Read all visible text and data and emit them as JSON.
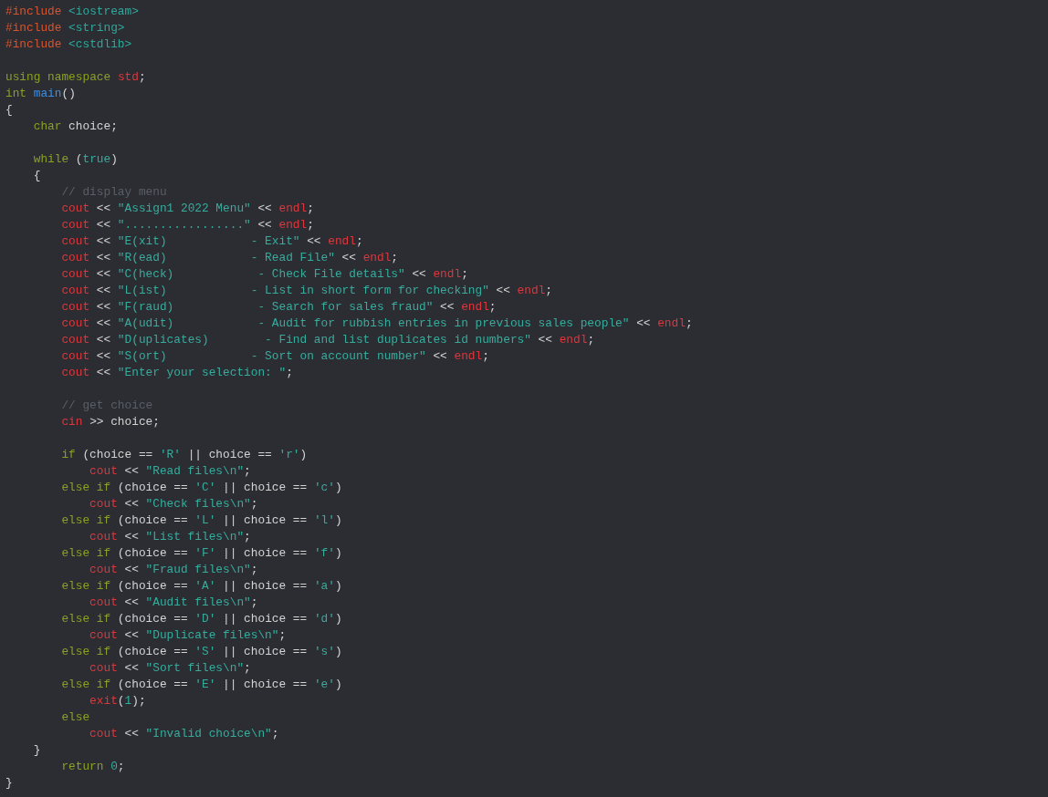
{
  "editor": {
    "lines": [
      {
        "kind": "code",
        "tokens": [
          {
            "kind": "pp",
            "text": "#include"
          },
          {
            "kind": "inc",
            "text": " <iostream>"
          }
        ]
      },
      {
        "kind": "code",
        "tokens": [
          {
            "kind": "pp",
            "text": "#include"
          },
          {
            "kind": "inc",
            "text": " <string>"
          }
        ]
      },
      {
        "kind": "code",
        "tokens": [
          {
            "kind": "pp",
            "text": "#include"
          },
          {
            "kind": "inc",
            "text": " <cstdlib>"
          }
        ]
      },
      {
        "kind": "blank"
      },
      {
        "kind": "code",
        "tokens": [
          {
            "kind": "kw",
            "text": "using namespace"
          },
          {
            "kind": "ns",
            "text": " std"
          },
          {
            "kind": "p",
            "text": ";"
          }
        ]
      },
      {
        "kind": "code",
        "tokens": [
          {
            "kind": "kw",
            "text": "int"
          },
          {
            "kind": "fn",
            "text": " main"
          },
          {
            "kind": "p",
            "text": "()"
          }
        ]
      },
      {
        "kind": "code",
        "tokens": [
          {
            "kind": "p",
            "text": "{"
          }
        ]
      },
      {
        "kind": "block",
        "children": [
          {
            "kind": "code",
            "tokens": [
              {
                "kind": "kw",
                "text": "char"
              },
              {
                "kind": "p",
                "text": " choice;"
              }
            ]
          },
          {
            "kind": "blank"
          },
          {
            "kind": "code",
            "tokens": [
              {
                "kind": "kw",
                "text": "while"
              },
              {
                "kind": "p",
                "text": " ("
              },
              {
                "kind": "n",
                "text": "true"
              },
              {
                "kind": "p",
                "text": ")"
              }
            ]
          },
          {
            "kind": "code",
            "tokens": [
              {
                "kind": "p",
                "text": "{"
              }
            ]
          },
          {
            "kind": "block",
            "children": [
              {
                "kind": "code",
                "tokens": [
                  {
                    "kind": "c",
                    "text": "// display menu"
                  }
                ]
              },
              {
                "kind": "code",
                "tokens": [
                  {
                    "kind": "io",
                    "text": "cout"
                  },
                  {
                    "kind": "p",
                    "text": " << "
                  },
                  {
                    "kind": "s",
                    "text": "\"Assign1 2022 Menu\""
                  },
                  {
                    "kind": "p",
                    "text": " << "
                  },
                  {
                    "kind": "io",
                    "text": "endl"
                  },
                  {
                    "kind": "p",
                    "text": ";"
                  }
                ]
              },
              {
                "kind": "code",
                "tokens": [
                  {
                    "kind": "io",
                    "text": "cout"
                  },
                  {
                    "kind": "p",
                    "text": " << "
                  },
                  {
                    "kind": "s",
                    "text": "\".................\""
                  },
                  {
                    "kind": "p",
                    "text": " << "
                  },
                  {
                    "kind": "io",
                    "text": "endl"
                  },
                  {
                    "kind": "p",
                    "text": ";"
                  }
                ]
              },
              {
                "kind": "code",
                "tokens": [
                  {
                    "kind": "io",
                    "text": "cout"
                  },
                  {
                    "kind": "p",
                    "text": " << "
                  },
                  {
                    "kind": "s",
                    "text": "\"E(xit)            - Exit\""
                  },
                  {
                    "kind": "p",
                    "text": " << "
                  },
                  {
                    "kind": "io",
                    "text": "endl"
                  },
                  {
                    "kind": "p",
                    "text": ";"
                  }
                ]
              },
              {
                "kind": "code",
                "tokens": [
                  {
                    "kind": "io",
                    "text": "cout"
                  },
                  {
                    "kind": "p",
                    "text": " << "
                  },
                  {
                    "kind": "s",
                    "text": "\"R(ead)            - Read File\""
                  },
                  {
                    "kind": "p",
                    "text": " << "
                  },
                  {
                    "kind": "io",
                    "text": "endl"
                  },
                  {
                    "kind": "p",
                    "text": ";"
                  }
                ]
              },
              {
                "kind": "code",
                "tokens": [
                  {
                    "kind": "io",
                    "text": "cout"
                  },
                  {
                    "kind": "p",
                    "text": " << "
                  },
                  {
                    "kind": "s",
                    "text": "\"C(heck)            - Check File details\""
                  },
                  {
                    "kind": "p",
                    "text": " << "
                  },
                  {
                    "kind": "io",
                    "text": "endl"
                  },
                  {
                    "kind": "p",
                    "text": ";"
                  }
                ]
              },
              {
                "kind": "code",
                "tokens": [
                  {
                    "kind": "io",
                    "text": "cout"
                  },
                  {
                    "kind": "p",
                    "text": " << "
                  },
                  {
                    "kind": "s",
                    "text": "\"L(ist)            - List in short form for checking\""
                  },
                  {
                    "kind": "p",
                    "text": " << "
                  },
                  {
                    "kind": "io",
                    "text": "endl"
                  },
                  {
                    "kind": "p",
                    "text": ";"
                  }
                ]
              },
              {
                "kind": "code",
                "tokens": [
                  {
                    "kind": "io",
                    "text": "cout"
                  },
                  {
                    "kind": "p",
                    "text": " << "
                  },
                  {
                    "kind": "s",
                    "text": "\"F(raud)            - Search for sales fraud\""
                  },
                  {
                    "kind": "p",
                    "text": " << "
                  },
                  {
                    "kind": "io",
                    "text": "endl"
                  },
                  {
                    "kind": "p",
                    "text": ";"
                  }
                ]
              },
              {
                "kind": "code",
                "tokens": [
                  {
                    "kind": "io",
                    "text": "cout"
                  },
                  {
                    "kind": "p",
                    "text": " << "
                  },
                  {
                    "kind": "s",
                    "text": "\"A(udit)            - Audit for rubbish entries in previous sales people\""
                  },
                  {
                    "kind": "p",
                    "text": " << "
                  },
                  {
                    "kind": "io",
                    "text": "endl"
                  },
                  {
                    "kind": "p",
                    "text": ";"
                  }
                ]
              },
              {
                "kind": "code",
                "tokens": [
                  {
                    "kind": "io",
                    "text": "cout"
                  },
                  {
                    "kind": "p",
                    "text": " << "
                  },
                  {
                    "kind": "s",
                    "text": "\"D(uplicates)        - Find and list duplicates id numbers\""
                  },
                  {
                    "kind": "p",
                    "text": " << "
                  },
                  {
                    "kind": "io",
                    "text": "endl"
                  },
                  {
                    "kind": "p",
                    "text": ";"
                  }
                ]
              },
              {
                "kind": "code",
                "tokens": [
                  {
                    "kind": "io",
                    "text": "cout"
                  },
                  {
                    "kind": "p",
                    "text": " << "
                  },
                  {
                    "kind": "s",
                    "text": "\"S(ort)            - Sort on account number\""
                  },
                  {
                    "kind": "p",
                    "text": " << "
                  },
                  {
                    "kind": "io",
                    "text": "endl"
                  },
                  {
                    "kind": "p",
                    "text": ";"
                  }
                ]
              },
              {
                "kind": "code",
                "tokens": [
                  {
                    "kind": "io",
                    "text": "cout"
                  },
                  {
                    "kind": "p",
                    "text": " << "
                  },
                  {
                    "kind": "s",
                    "text": "\"Enter your selection: \""
                  },
                  {
                    "kind": "p",
                    "text": ";"
                  }
                ]
              },
              {
                "kind": "blank"
              },
              {
                "kind": "code",
                "tokens": [
                  {
                    "kind": "c",
                    "text": "// get choice"
                  }
                ]
              },
              {
                "kind": "code",
                "tokens": [
                  {
                    "kind": "io",
                    "text": "cin"
                  },
                  {
                    "kind": "p",
                    "text": " >> choice;"
                  }
                ]
              },
              {
                "kind": "blank"
              },
              {
                "kind": "code",
                "tokens": [
                  {
                    "kind": "kw",
                    "text": "if"
                  },
                  {
                    "kind": "p",
                    "text": " (choice == "
                  },
                  {
                    "kind": "s",
                    "text": "'R'"
                  },
                  {
                    "kind": "p",
                    "text": " || choice == "
                  },
                  {
                    "kind": "s",
                    "text": "'r'"
                  },
                  {
                    "kind": "p",
                    "text": ")"
                  }
                ]
              },
              {
                "kind": "block",
                "children": [
                  {
                    "kind": "code",
                    "tokens": [
                      {
                        "kind": "io",
                        "text": "cout"
                      },
                      {
                        "kind": "p",
                        "text": " << "
                      },
                      {
                        "kind": "s",
                        "text": "\"Read files\\n\""
                      },
                      {
                        "kind": "p",
                        "text": ";"
                      }
                    ]
                  }
                ]
              },
              {
                "kind": "code",
                "tokens": [
                  {
                    "kind": "kw",
                    "text": "else if"
                  },
                  {
                    "kind": "p",
                    "text": " (choice == "
                  },
                  {
                    "kind": "s",
                    "text": "'C'"
                  },
                  {
                    "kind": "p",
                    "text": " || choice == "
                  },
                  {
                    "kind": "s",
                    "text": "'c'"
                  },
                  {
                    "kind": "p",
                    "text": ")"
                  }
                ]
              },
              {
                "kind": "block",
                "children": [
                  {
                    "kind": "code",
                    "tokens": [
                      {
                        "kind": "io",
                        "text": "cout"
                      },
                      {
                        "kind": "p",
                        "text": " << "
                      },
                      {
                        "kind": "s",
                        "text": "\"Check files\\n\""
                      },
                      {
                        "kind": "p",
                        "text": ";"
                      }
                    ]
                  }
                ]
              },
              {
                "kind": "code",
                "tokens": [
                  {
                    "kind": "kw",
                    "text": "else if"
                  },
                  {
                    "kind": "p",
                    "text": " (choice == "
                  },
                  {
                    "kind": "s",
                    "text": "'L'"
                  },
                  {
                    "kind": "p",
                    "text": " || choice == "
                  },
                  {
                    "kind": "s",
                    "text": "'l'"
                  },
                  {
                    "kind": "p",
                    "text": ")"
                  }
                ]
              },
              {
                "kind": "block",
                "children": [
                  {
                    "kind": "code",
                    "tokens": [
                      {
                        "kind": "io",
                        "text": "cout"
                      },
                      {
                        "kind": "p",
                        "text": " << "
                      },
                      {
                        "kind": "s",
                        "text": "\"List files\\n\""
                      },
                      {
                        "kind": "p",
                        "text": ";"
                      }
                    ]
                  }
                ]
              },
              {
                "kind": "code",
                "tokens": [
                  {
                    "kind": "kw",
                    "text": "else if"
                  },
                  {
                    "kind": "p",
                    "text": " (choice == "
                  },
                  {
                    "kind": "s",
                    "text": "'F'"
                  },
                  {
                    "kind": "p",
                    "text": " || choice == "
                  },
                  {
                    "kind": "s",
                    "text": "'f'"
                  },
                  {
                    "kind": "p",
                    "text": ")"
                  }
                ]
              },
              {
                "kind": "block",
                "children": [
                  {
                    "kind": "code",
                    "tokens": [
                      {
                        "kind": "io",
                        "text": "cout"
                      },
                      {
                        "kind": "p",
                        "text": " << "
                      },
                      {
                        "kind": "s",
                        "text": "\"Fraud files\\n\""
                      },
                      {
                        "kind": "p",
                        "text": ";"
                      }
                    ]
                  }
                ]
              },
              {
                "kind": "code",
                "tokens": [
                  {
                    "kind": "kw",
                    "text": "else if"
                  },
                  {
                    "kind": "p",
                    "text": " (choice == "
                  },
                  {
                    "kind": "s",
                    "text": "'A'"
                  },
                  {
                    "kind": "p",
                    "text": " || choice == "
                  },
                  {
                    "kind": "s",
                    "text": "'a'"
                  },
                  {
                    "kind": "p",
                    "text": ")"
                  }
                ]
              },
              {
                "kind": "block",
                "children": [
                  {
                    "kind": "code",
                    "tokens": [
                      {
                        "kind": "io",
                        "text": "cout"
                      },
                      {
                        "kind": "p",
                        "text": " << "
                      },
                      {
                        "kind": "s",
                        "text": "\"Audit files\\n\""
                      },
                      {
                        "kind": "p",
                        "text": ";"
                      }
                    ]
                  }
                ]
              },
              {
                "kind": "code",
                "tokens": [
                  {
                    "kind": "kw",
                    "text": "else if"
                  },
                  {
                    "kind": "p",
                    "text": " (choice == "
                  },
                  {
                    "kind": "s",
                    "text": "'D'"
                  },
                  {
                    "kind": "p",
                    "text": " || choice == "
                  },
                  {
                    "kind": "s",
                    "text": "'d'"
                  },
                  {
                    "kind": "p",
                    "text": ")"
                  }
                ]
              },
              {
                "kind": "block",
                "children": [
                  {
                    "kind": "code",
                    "tokens": [
                      {
                        "kind": "io",
                        "text": "cout"
                      },
                      {
                        "kind": "p",
                        "text": " << "
                      },
                      {
                        "kind": "s",
                        "text": "\"Duplicate files\\n\""
                      },
                      {
                        "kind": "p",
                        "text": ";"
                      }
                    ]
                  }
                ]
              },
              {
                "kind": "code",
                "tokens": [
                  {
                    "kind": "kw",
                    "text": "else if"
                  },
                  {
                    "kind": "p",
                    "text": " (choice == "
                  },
                  {
                    "kind": "s",
                    "text": "'S'"
                  },
                  {
                    "kind": "p",
                    "text": " || choice == "
                  },
                  {
                    "kind": "s",
                    "text": "'s'"
                  },
                  {
                    "kind": "p",
                    "text": ")"
                  }
                ]
              },
              {
                "kind": "block",
                "children": [
                  {
                    "kind": "code",
                    "tokens": [
                      {
                        "kind": "io",
                        "text": "cout"
                      },
                      {
                        "kind": "p",
                        "text": " << "
                      },
                      {
                        "kind": "s",
                        "text": "\"Sort files\\n\""
                      },
                      {
                        "kind": "p",
                        "text": ";"
                      }
                    ]
                  }
                ]
              },
              {
                "kind": "code",
                "tokens": [
                  {
                    "kind": "kw",
                    "text": "else if"
                  },
                  {
                    "kind": "p",
                    "text": " (choice == "
                  },
                  {
                    "kind": "s",
                    "text": "'E'"
                  },
                  {
                    "kind": "p",
                    "text": " || choice == "
                  },
                  {
                    "kind": "s",
                    "text": "'e'"
                  },
                  {
                    "kind": "p",
                    "text": ")"
                  }
                ]
              },
              {
                "kind": "block",
                "children": [
                  {
                    "kind": "code",
                    "tokens": [
                      {
                        "kind": "io",
                        "text": "exit"
                      },
                      {
                        "kind": "p",
                        "text": "("
                      },
                      {
                        "kind": "n",
                        "text": "1"
                      },
                      {
                        "kind": "p",
                        "text": ");"
                      }
                    ]
                  }
                ]
              },
              {
                "kind": "code",
                "tokens": [
                  {
                    "kind": "kw",
                    "text": "else"
                  }
                ]
              },
              {
                "kind": "block",
                "children": [
                  {
                    "kind": "code",
                    "tokens": [
                      {
                        "kind": "io",
                        "text": "cout"
                      },
                      {
                        "kind": "p",
                        "text": " << "
                      },
                      {
                        "kind": "s",
                        "text": "\"Invalid choice\\n\""
                      },
                      {
                        "kind": "p",
                        "text": ";"
                      }
                    ]
                  }
                ]
              }
            ]
          },
          {
            "kind": "code",
            "tokens": [
              {
                "kind": "p",
                "text": "}"
              }
            ]
          },
          {
            "kind": "block",
            "children": [
              {
                "kind": "code",
                "tokens": [
                  {
                    "kind": "kw",
                    "text": "return"
                  },
                  {
                    "kind": "n",
                    "text": " 0"
                  },
                  {
                    "kind": "p",
                    "text": ";"
                  }
                ]
              }
            ]
          }
        ]
      },
      {
        "kind": "code",
        "tokens": [
          {
            "kind": "p",
            "text": "}"
          }
        ]
      }
    ]
  }
}
